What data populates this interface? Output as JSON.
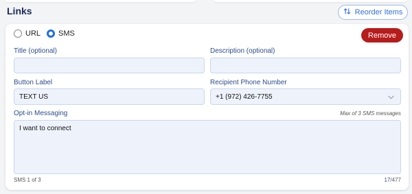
{
  "section": {
    "title": "Links",
    "reorder_label": "Reorder Items"
  },
  "link_type": {
    "options": [
      "URL",
      "SMS"
    ],
    "selected": "SMS"
  },
  "remove_label": "Remove",
  "fields": {
    "title": {
      "label": "Title (optional)",
      "value": ""
    },
    "description": {
      "label": "Description (optional)",
      "value": ""
    },
    "button_label": {
      "label": "Button Label",
      "value": "TEXT US"
    },
    "recipient_phone": {
      "label": "Recipient Phone Number",
      "value": "+1 (972) 426-7755"
    },
    "opt_in": {
      "label": "Opt-in Messaging",
      "hint": "Max of 3 SMS messages",
      "value": "I want to connect",
      "sms_count": "SMS 1 of 3",
      "char_current": "17",
      "char_max": "/477"
    }
  },
  "colors": {
    "accent": "#1f6fe0",
    "danger": "#b71c1c",
    "title": "#1a2b5c",
    "field_bg": "#eef3fb"
  },
  "icons": {
    "reorder": "arrows-up-down-icon",
    "select": "chevron-down-icon"
  }
}
